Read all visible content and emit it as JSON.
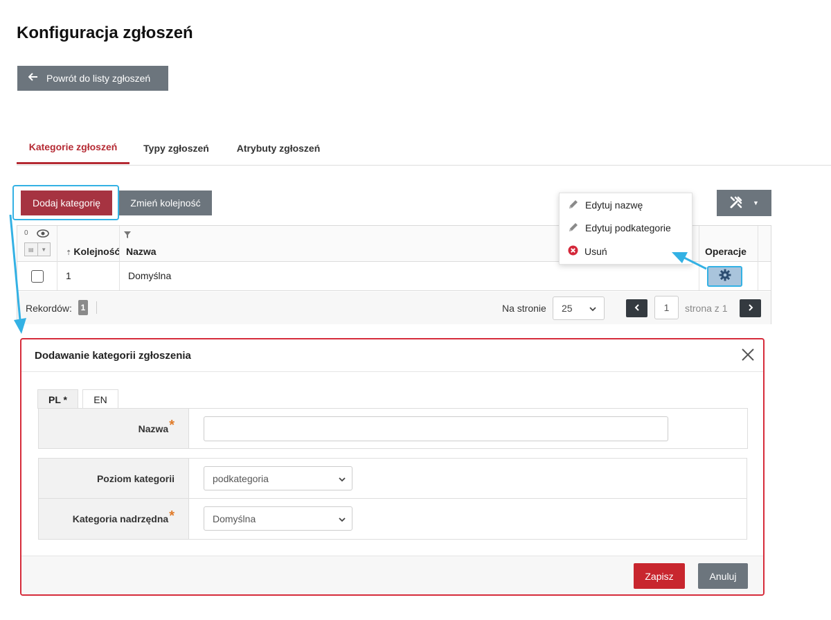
{
  "page": {
    "title": "Konfiguracja zgłoszeń"
  },
  "back_button": {
    "label": "Powrót do listy zgłoszeń"
  },
  "tabs": [
    {
      "label": "Kategorie zgłoszeń",
      "active": true
    },
    {
      "label": "Typy zgłoszeń",
      "active": false
    },
    {
      "label": "Atrybuty zgłoszeń",
      "active": false
    }
  ],
  "toolbar": {
    "add_label": "Dodaj kategorię",
    "order_label": "Zmień kolejność"
  },
  "grid": {
    "hidden_count": "0",
    "columns": [
      "Kolejność",
      "Nazwa",
      "Operacje"
    ],
    "rows": [
      {
        "order": "1",
        "name": "Domyślna"
      }
    ],
    "footer": {
      "records_label": "Rekordów:",
      "records_count": "1",
      "per_page_label": "Na stronie",
      "per_page_value": "25",
      "page_value": "1",
      "page_of": "strona z 1"
    }
  },
  "dropdown": {
    "items": [
      {
        "label": "Edytuj nazwę",
        "icon": "pencil-icon"
      },
      {
        "label": "Edytuj podkategorie",
        "icon": "pencil-icon"
      },
      {
        "label": "Usuń",
        "icon": "delete-circle-icon"
      }
    ]
  },
  "modal": {
    "title": "Dodawanie kategorii zgłoszenia",
    "lang_tabs": [
      "PL *",
      "EN"
    ],
    "fields": {
      "name_label": "Nazwa",
      "name_value": "",
      "level_label": "Poziom kategorii",
      "level_value": "podkategoria",
      "parent_label": "Kategoria nadrzędna",
      "parent_value": "Domyślna"
    },
    "required_mark": "*",
    "save_label": "Zapisz",
    "cancel_label": "Anuluj"
  },
  "colors": {
    "accent": "#b52a33",
    "add_button": "#a63341",
    "secondary": "#6c757d",
    "highlight": "#33b1e4",
    "modal_border": "#d62b3a",
    "save_button": "#c8262e"
  }
}
